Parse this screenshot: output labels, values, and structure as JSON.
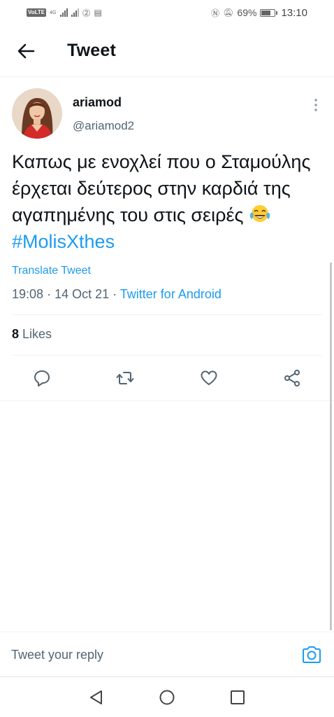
{
  "status_bar": {
    "volte": "VoLTE",
    "network": "4G",
    "battery_percent": "69%",
    "battery_level": 0.69,
    "time": "13:10"
  },
  "header": {
    "title": "Tweet",
    "back_icon": "arrow-left-icon"
  },
  "tweet": {
    "author": {
      "display_name": "ariamod",
      "handle": "@ariamod2"
    },
    "text": "Καπως με ενοχλεί που ο Σταμούλης έρχεται δεύτερος στην καρδιά της αγαπημένης του στις σειρές",
    "emoji": "face-with-tears-of-joy",
    "hashtag": "#MolisXthes",
    "translate_label": "Translate Tweet",
    "time": "19:08",
    "date": "14 Oct 21",
    "source": "Twitter for Android",
    "likes_count": "8",
    "likes_label": "Likes"
  },
  "actions": [
    "reply-icon",
    "retweet-icon",
    "like-icon",
    "share-icon"
  ],
  "reply_bar": {
    "placeholder": "Tweet your reply"
  },
  "colors": {
    "accent": "#1d9bf0",
    "text": "#0f1419",
    "secondary": "#536471"
  }
}
